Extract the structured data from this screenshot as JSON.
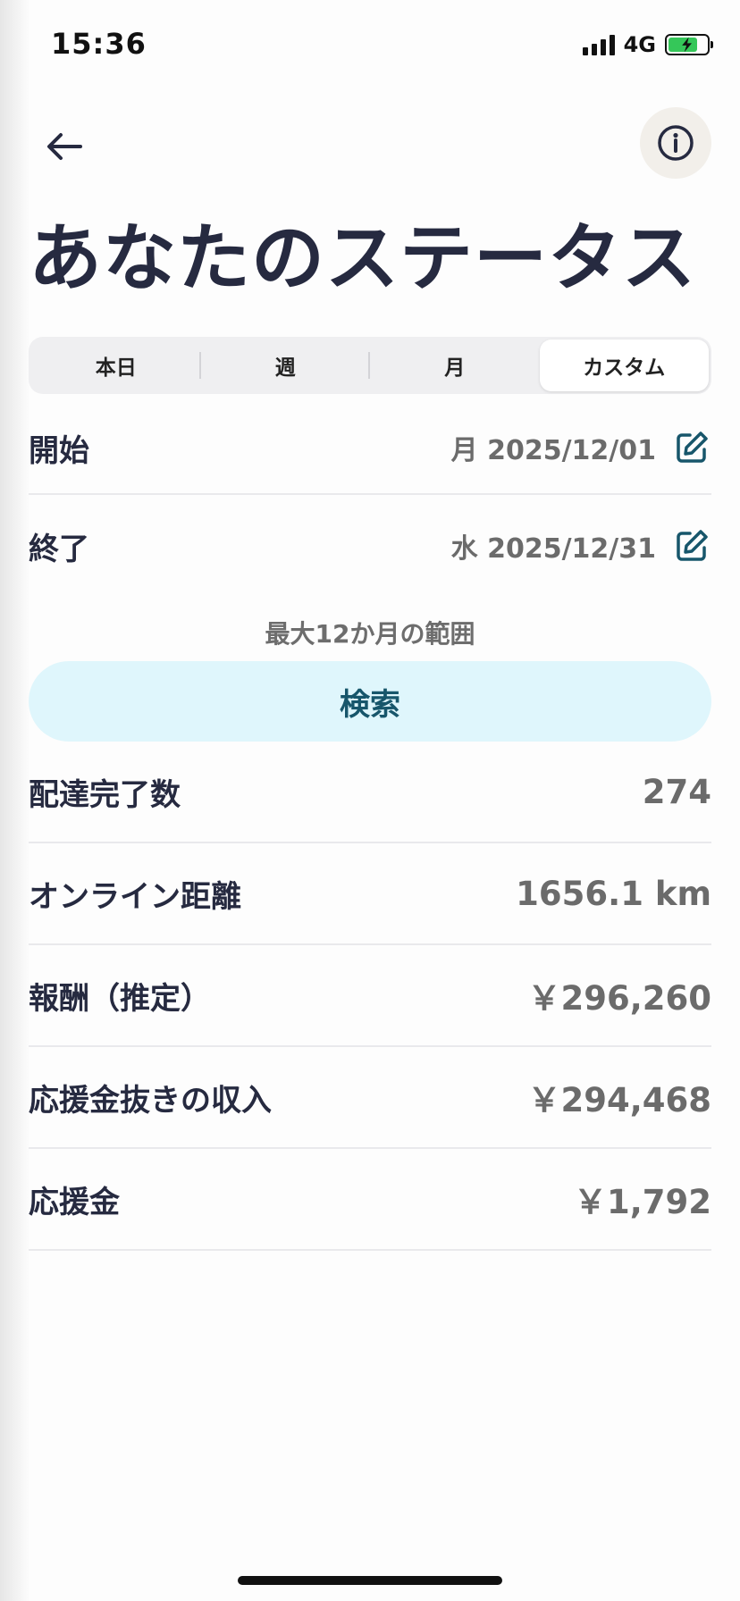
{
  "status_bar": {
    "time": "15:36",
    "network": "4G",
    "battery_level": 0.75
  },
  "header": {
    "title": "あなたのステータス",
    "back_icon": "arrow-left-icon",
    "info_icon": "info-circle-icon"
  },
  "tabs": [
    {
      "label": "本日",
      "active": false
    },
    {
      "label": "週",
      "active": false
    },
    {
      "label": "月",
      "active": false
    },
    {
      "label": "カスタム",
      "active": true
    }
  ],
  "date_range": {
    "start": {
      "label": "開始",
      "value": "月 2025/12/01"
    },
    "end": {
      "label": "終了",
      "value": "水 2025/12/31"
    },
    "note": "最大12か月の範囲"
  },
  "search_button": {
    "label": "検索"
  },
  "stats": [
    {
      "label": "配達完了数",
      "value": "274"
    },
    {
      "label": "オンライン距離",
      "value": "1656.1 km"
    },
    {
      "label": "報酬（推定）",
      "value": "￥296,260"
    },
    {
      "label": "応援金抜きの収入",
      "value": "￥294,468"
    },
    {
      "label": "応援金",
      "value": "￥1,792"
    }
  ],
  "colors": {
    "accent": "#17566b",
    "search_bg": "#dff6fc",
    "text_primary": "#262a40",
    "text_secondary": "#6b6b6b",
    "battery": "#35c759"
  }
}
